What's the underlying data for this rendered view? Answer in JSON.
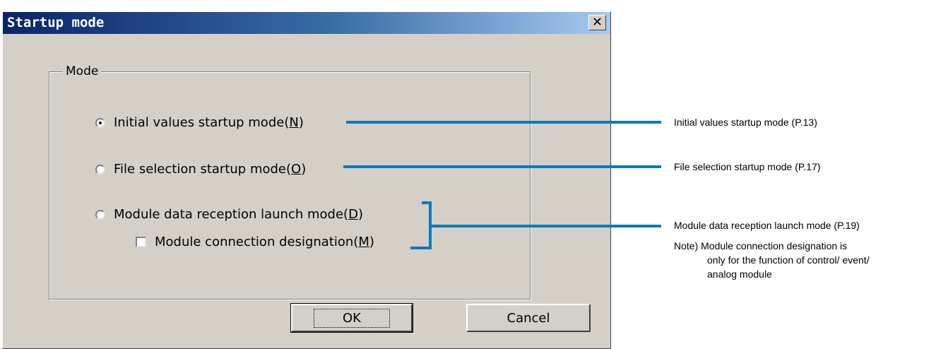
{
  "dialog": {
    "title": "Startup mode",
    "close_glyph": "✕",
    "group_label": "Mode",
    "options": [
      {
        "label_pre": "Initial values startup mode(",
        "accel": "N",
        "label_post": ")",
        "checked": true
      },
      {
        "label_pre": "File selection startup mode(",
        "accel": "O",
        "label_post": ")",
        "checked": false
      },
      {
        "label_pre": "Module data reception launch mode(",
        "accel": "D",
        "label_post": ")",
        "checked": false
      }
    ],
    "checkbox": {
      "label_pre": "Module connection designation(",
      "accel": "M",
      "label_post": ")",
      "checked": false
    },
    "ok_label": "OK",
    "cancel_label": "Cancel"
  },
  "callouts": {
    "initial": "Initial values startup mode (P.13)",
    "file": "File selection startup mode (P.17)",
    "module": "Module data reception launch mode (P.19)",
    "note_prefix": "Note)",
    "note_line1": "Module connection designation is",
    "note_line2": "only for the function of control/ event/",
    "note_line3": "analog module"
  },
  "colors": {
    "callout_line": "#0b7ab8",
    "dialog_bg": "#d4d0c8",
    "title_start": "#0a246a"
  }
}
